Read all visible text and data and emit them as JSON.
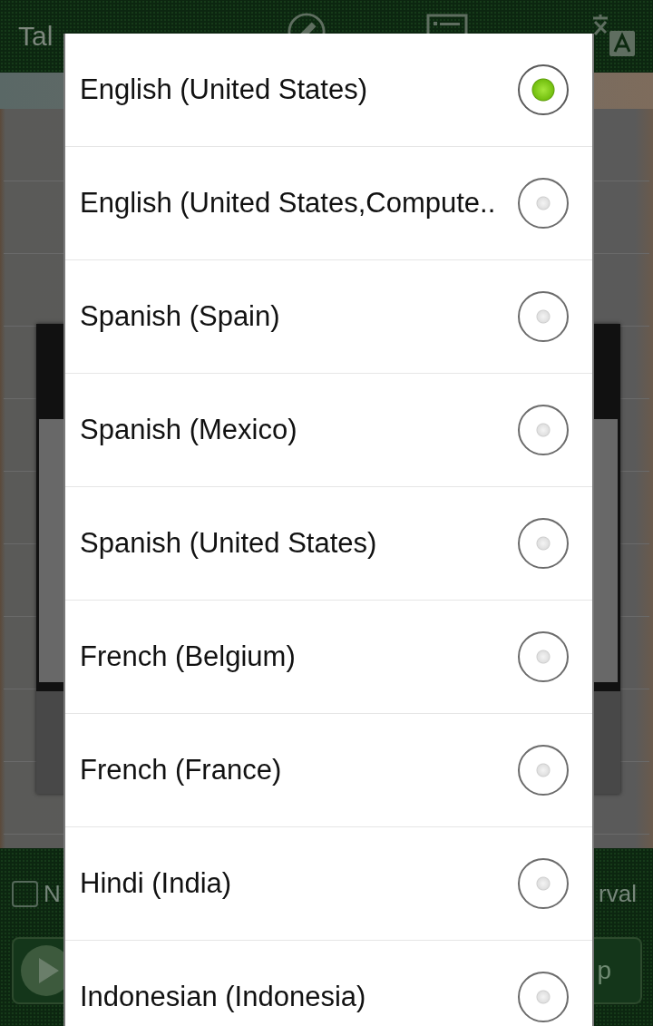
{
  "app_bar": {
    "title": "Tal"
  },
  "bottom_bar": {
    "checkbox": {
      "checked": false
    },
    "left_label": "N",
    "right_label": "rval",
    "button_label": "p"
  },
  "language_dialog": {
    "options": [
      {
        "label": "English (United States)",
        "selected": true
      },
      {
        "label": "English (United States,Compute..",
        "selected": false
      },
      {
        "label": "Spanish (Spain)",
        "selected": false
      },
      {
        "label": "Spanish (Mexico)",
        "selected": false
      },
      {
        "label": "Spanish (United States)",
        "selected": false
      },
      {
        "label": "French (Belgium)",
        "selected": false
      },
      {
        "label": "French (France)",
        "selected": false
      },
      {
        "label": "Hindi (India)",
        "selected": false
      },
      {
        "label": "Indonesian (Indonesia)",
        "selected": false
      }
    ]
  }
}
